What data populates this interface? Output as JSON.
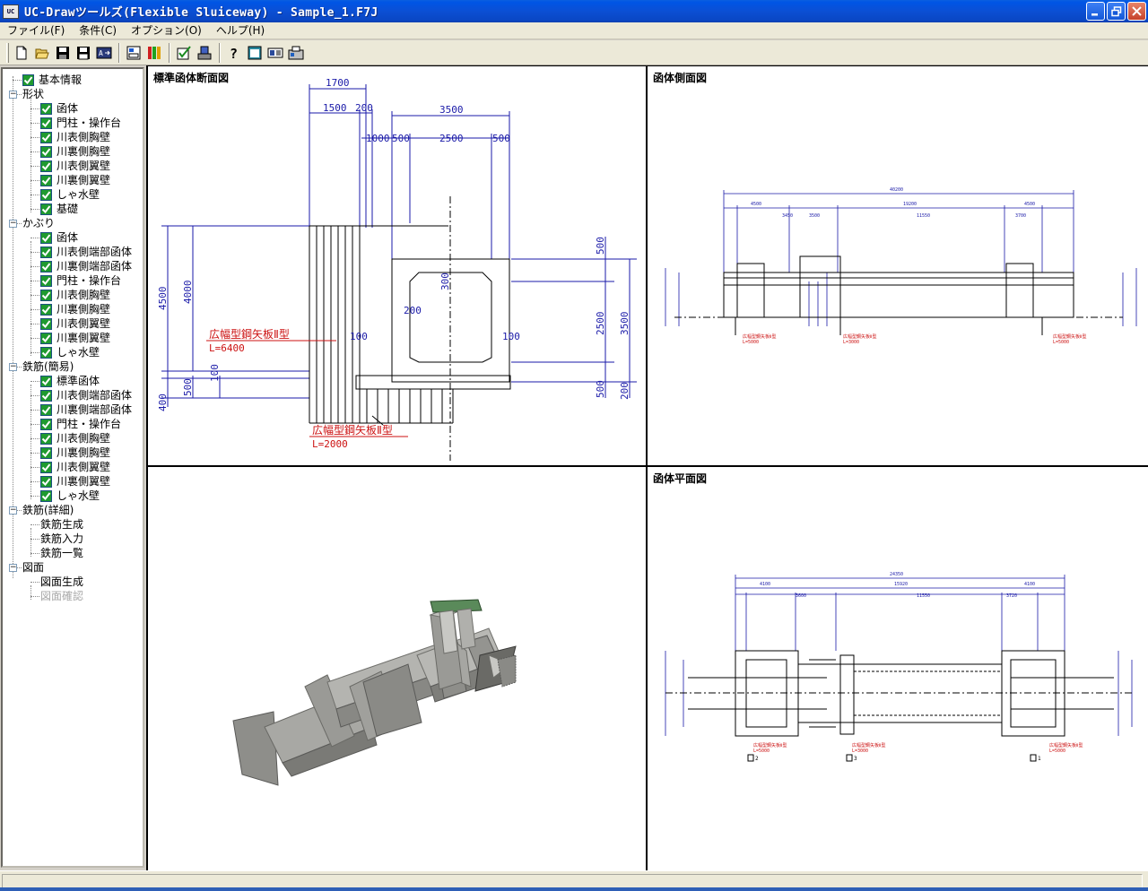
{
  "window": {
    "title": "UC-Drawツールズ(Flexible Sluiceway) - Sample_1.F7J",
    "app_icon_text": "UC"
  },
  "menu": [
    {
      "label": "ファイル(F)"
    },
    {
      "label": "条件(C)"
    },
    {
      "label": "オプション(O)"
    },
    {
      "label": "ヘルプ(H)"
    }
  ],
  "toolbar": {
    "icons": [
      "new-icon",
      "open-icon",
      "save-icon",
      "save-as-icon",
      "export-icon",
      "view-icon",
      "grid-icon",
      "check-icon",
      "print-icon",
      "help-icon",
      "window-icon",
      "layout-icon",
      "settings-icon"
    ]
  },
  "tree": [
    {
      "label": "基本情報",
      "level": 0,
      "check": true,
      "toggle": ""
    },
    {
      "label": "形状",
      "level": 0,
      "check": false,
      "toggle": "−"
    },
    {
      "label": "函体",
      "level": 1,
      "check": true
    },
    {
      "label": "門柱・操作台",
      "level": 1,
      "check": true
    },
    {
      "label": "川表側胸壁",
      "level": 1,
      "check": true
    },
    {
      "label": "川裏側胸壁",
      "level": 1,
      "check": true
    },
    {
      "label": "川表側翼壁",
      "level": 1,
      "check": true
    },
    {
      "label": "川裏側翼壁",
      "level": 1,
      "check": true
    },
    {
      "label": "しゃ水壁",
      "level": 1,
      "check": true
    },
    {
      "label": "基礎",
      "level": 1,
      "check": true
    },
    {
      "label": "かぶり",
      "level": 0,
      "check": false,
      "toggle": "−"
    },
    {
      "label": "函体",
      "level": 1,
      "check": true
    },
    {
      "label": "川表側端部函体",
      "level": 1,
      "check": true
    },
    {
      "label": "川裏側端部函体",
      "level": 1,
      "check": true
    },
    {
      "label": "門柱・操作台",
      "level": 1,
      "check": true
    },
    {
      "label": "川表側胸壁",
      "level": 1,
      "check": true
    },
    {
      "label": "川裏側胸壁",
      "level": 1,
      "check": true
    },
    {
      "label": "川表側翼壁",
      "level": 1,
      "check": true
    },
    {
      "label": "川裏側翼壁",
      "level": 1,
      "check": true
    },
    {
      "label": "しゃ水壁",
      "level": 1,
      "check": true
    },
    {
      "label": "鉄筋(簡易)",
      "level": 0,
      "check": false,
      "toggle": "−"
    },
    {
      "label": "標準函体",
      "level": 1,
      "check": true
    },
    {
      "label": "川表側端部函体",
      "level": 1,
      "check": true
    },
    {
      "label": "川裏側端部函体",
      "level": 1,
      "check": true
    },
    {
      "label": "門柱・操作台",
      "level": 1,
      "check": true
    },
    {
      "label": "川表側胸壁",
      "level": 1,
      "check": true
    },
    {
      "label": "川裏側胸壁",
      "level": 1,
      "check": true
    },
    {
      "label": "川表側翼壁",
      "level": 1,
      "check": true
    },
    {
      "label": "川裏側翼壁",
      "level": 1,
      "check": true
    },
    {
      "label": "しゃ水壁",
      "level": 1,
      "check": true
    },
    {
      "label": "鉄筋(詳細)",
      "level": 0,
      "check": false,
      "toggle": "−"
    },
    {
      "label": "鉄筋生成",
      "level": 1,
      "check": false
    },
    {
      "label": "鉄筋入力",
      "level": 1,
      "check": false
    },
    {
      "label": "鉄筋一覧",
      "level": 1,
      "check": false
    },
    {
      "label": "図面",
      "level": 0,
      "check": false,
      "toggle": "−"
    },
    {
      "label": "図面生成",
      "level": 1,
      "check": false
    },
    {
      "label": "図面確認",
      "level": 1,
      "check": false,
      "disabled": true
    }
  ],
  "panes": {
    "section": {
      "title": "標準函体断面図",
      "dims": {
        "d1700": "1700",
        "d1500": "1500",
        "d200a": "200",
        "d3500": "3500",
        "d1000": "1000",
        "d500a": "500",
        "d2500": "2500",
        "d500b": "500",
        "d4500": "4500",
        "d4000": "4000",
        "d500c": "500",
        "d100a": "100",
        "d400": "400",
        "d300": "300",
        "d200b": "200",
        "d100b": "100",
        "d100c": "100",
        "d500r": "500",
        "d2500r": "2500",
        "d3500r": "3500",
        "d500r2": "500",
        "d200r": "200"
      },
      "pile1_label": "広幅型鋼矢板Ⅱ型",
      "pile1_length": "L=6400",
      "pile2_label": "広幅型鋼矢板Ⅱ型",
      "pile2_length": "L=2000"
    },
    "side": {
      "title": "函体側面図"
    },
    "view3d": {
      "title": ""
    },
    "plan": {
      "title": "函体平面図"
    }
  },
  "colors": {
    "title_blue": "#0a4fd4",
    "drawing_blue": "#1a1aa8",
    "annotation_red": "#cc1111",
    "check_green": "#1f9a2f"
  }
}
